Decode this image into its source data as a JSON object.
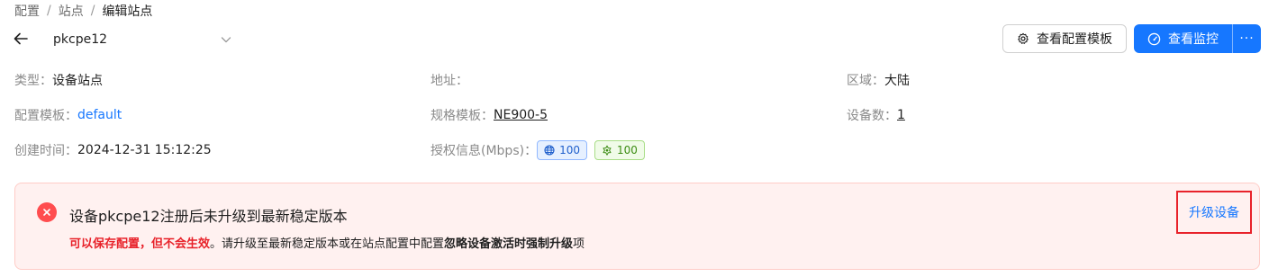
{
  "breadcrumb": {
    "items": [
      "配置",
      "站点",
      "编辑站点"
    ],
    "separator": "/"
  },
  "header": {
    "site_name": "pkcpe12",
    "view_template_label": "查看配置模板",
    "view_monitor_label": "查看监控",
    "more_label": "···"
  },
  "info": {
    "type_label": "类型：",
    "type_value": "设备站点",
    "address_label": "地址：",
    "address_value": "",
    "region_label": "区域：",
    "region_value": "大陆",
    "config_template_label": "配置模板：",
    "config_template_value": "default",
    "spec_template_label": "规格模板：",
    "spec_template_value": "NE900-5",
    "device_count_label": "设备数：",
    "device_count_value": "1",
    "created_label": "创建时间：",
    "created_value": "2024-12-31 15:12:25",
    "license_label": "授权信息(Mbps)：",
    "license_tags": [
      {
        "icon": "globe-icon",
        "value": "100",
        "color": "#1f5fcc"
      },
      {
        "icon": "flower-icon",
        "value": "100",
        "color": "#3b8c12"
      }
    ]
  },
  "alert": {
    "title": "设备pkcpe12注册后未升级到最新稳定版本",
    "desc_red": "可以保存配置，但不会生效",
    "desc_mid": "。请升级至最新稳定版本或在站点配置中配置",
    "desc_bold": "忽略设备激活时强制升级",
    "desc_end": "项",
    "action_label": "升级设备",
    "color": "#ff4d4f"
  },
  "colors": {
    "primary": "#1677ff",
    "danger": "#e8222a",
    "alert_bg": "#fff1f0"
  }
}
